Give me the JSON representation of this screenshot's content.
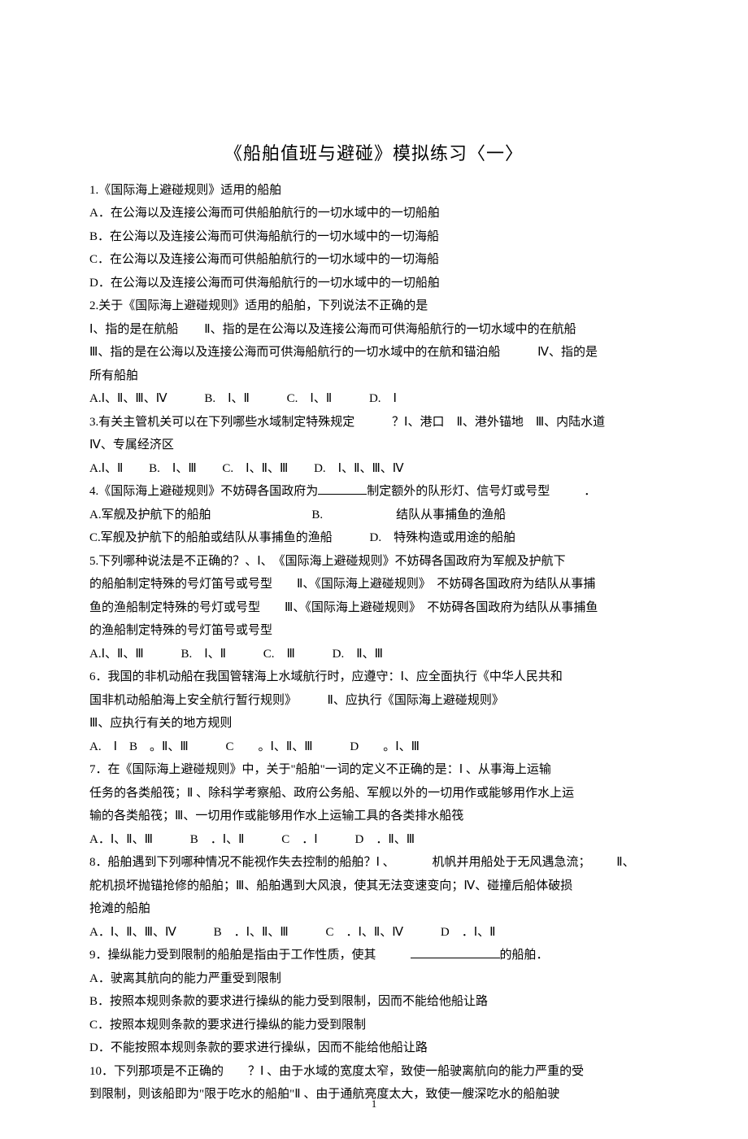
{
  "title": "《船舶值班与避碰》模拟练习〈一〉",
  "q1": {
    "stem": "1.《国际海上避碰规则》适用的船舶",
    "A": "A．在公海以及连接公海而可供船舶航行的一切水域中的一切船舶",
    "B": "B．在公海以及连接公海而可供海船航行的一切水域中的一切海船",
    "C": "C．在公海以及连接公海而可供船舶航行的一切水域中的一切海船",
    "D": "D．在公海以及连接公海而可供海船航行的一切水域中的一切船舶"
  },
  "q2": {
    "l1": "2.关于《国际海上避碰规则》适用的船舶，下列说法不正确的是",
    "l2a": "Ⅰ、指的是在航船",
    "l2b": "Ⅱ、指的是在公海以及连接公海而可供海船航行的一切水域中的在航船",
    "l3a": "Ⅲ、指的是在公海以及连接公海而可供海船航行的一切水域中的在航和锚泊船",
    "l3b": "Ⅳ、指的是",
    "l4": "所有船舶",
    "optA": "A.Ⅰ、Ⅱ、Ⅲ、Ⅳ",
    "optB": "B.　Ⅰ、Ⅱ",
    "optC": "C.　Ⅰ、Ⅱ",
    "optD": "D.　Ⅰ"
  },
  "q3": {
    "l1a": "3.有关主管机关可以在下列哪些水域制定特殊规定",
    "l1b": "？Ⅰ、港口　Ⅱ、港外锚地　Ⅲ、内陆水道",
    "l2": "Ⅳ、专属经济区",
    "optA": "A.Ⅰ、Ⅱ",
    "optB": "B.　Ⅰ、Ⅲ",
    "optC": "C.　Ⅰ、Ⅱ、Ⅲ",
    "optD": "D.　Ⅰ、Ⅱ、Ⅲ、Ⅳ"
  },
  "q4": {
    "l1a": "4.《国际海上避碰规则》不妨碍各国政府为",
    "l1b": "制定额外的队形灯、信号灯或号型",
    "l1c": "．",
    "optA": "A.军舰及护航下的船舶",
    "optB": "B.　　　　　　结队从事捕鱼的渔船",
    "optC": "C.军舰及护航下的船舶或结队从事捕鱼的渔船",
    "optD": "D.　特殊构造或用途的船舶"
  },
  "q5": {
    "l1": "5.下列哪种说法是不正确的？、Ⅰ、　《国际海上避碰规则》不妨碍各国政府为军舰及护航下",
    "l2": "的船舶制定特殊的号灯笛号或号型　　Ⅱ、《国际海上避碰规则》　不妨碍各国政府为结队从事捕",
    "l3": "鱼的渔船制定特殊的号灯或号型　　Ⅲ、《国际海上避碰规则》　不妨碍各国政府为结队从事捕鱼",
    "l4": "的渔船制定特殊的号灯笛号或号型",
    "optA": "A.Ⅰ、Ⅱ、Ⅲ",
    "optB": "B.　Ⅰ、Ⅱ",
    "optC": "C.　Ⅲ",
    "optD": "D.　Ⅱ、Ⅲ"
  },
  "q6": {
    "l1": "6．我国的非机动船在我国管辖海上水域航行时，应遵守：Ⅰ、应全面执行《中华人民共和",
    "l2": "国非机动船舶海上安全航行暂行规则》　　　Ⅱ、应执行《国际海上避碰规则》",
    "l3": "Ⅲ、应执行有关的地方规则",
    "optA": "A.　Ⅰ　B　。Ⅱ、Ⅲ",
    "optC": "C　　。Ⅰ、Ⅱ、Ⅲ",
    "optD": "D　　。Ⅰ、Ⅲ"
  },
  "q7": {
    "l1": "7．在《国际海上避碰规则》中，关于\"船舶\"一词的定义不正确的是：Ⅰ 、从事海上运输",
    "l2": "任务的各类船筏；Ⅱ 、除科学考察船、政府公务船、军舰以外的一切用作或能够用作水上运",
    "l3": "输的各类船筏；Ⅲ、一切用作或能够用作水上运输工具的各类排水船筏",
    "optA": "A．Ⅰ、Ⅱ、Ⅲ",
    "optB": "B　．Ⅰ、Ⅱ",
    "optC": "C　．Ⅰ",
    "optD": "D　．Ⅱ、Ⅲ"
  },
  "q8": {
    "l1a": "8．船舶遇到下列哪种情况不能视作失去控制的船舶？Ⅰ 、",
    "l1b": "机帆并用船处于无风遇急流；",
    "l1c": "Ⅱ、",
    "l2": "舵机损坏抛锚抢修的船舶；Ⅲ、船舶遇到大风浪，使其无法变速变向；Ⅳ、碰撞后船体破损",
    "l3": "抢滩的船舶",
    "optA": "A．Ⅰ、Ⅱ、Ⅲ、Ⅳ",
    "optB": "B　．Ⅰ、Ⅱ、Ⅲ",
    "optC": "C　．Ⅰ、Ⅱ、Ⅳ",
    "optD": "D　．Ⅰ、Ⅱ"
  },
  "q9": {
    "l1a": "9．操纵能力受到限制的船舶是指由于工作性质，使其",
    "l1b": "的船舶．",
    "A": "A．驶离其航向的能力严重受到限制",
    "B": "B．按照本规则条款的要求进行操纵的能力受到限制，因而不能给他船让路",
    "C": "C．按照本规则条款的要求进行操纵的能力受到限制",
    "D": "D．不能按照本规则条款的要求进行操纵，因而不能给他船让路"
  },
  "q10": {
    "l1": "10．下列那项是不正确的　　？Ⅰ 、由于水域的宽度太窄，致使一船驶离航向的能力严重的受",
    "l2": "到限制，则该船即为\"限于吃水的船舶\"Ⅱ 、由于通航亮度太大，致使一艘深吃水的船舶驶"
  },
  "pagenum": "1"
}
